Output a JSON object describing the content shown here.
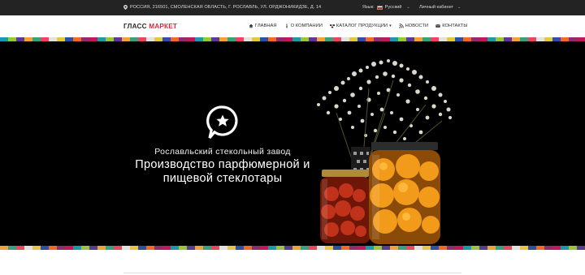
{
  "topbar": {
    "address": "РОССИЯ, 216501, СМОЛЕНСКАЯ ОБЛАСТЬ, Г. РОСЛАВЛЬ, УЛ. ОРДЖОНИКИДЗЕ, Д. 14",
    "language_label": "Язык:",
    "language_value": "Русский",
    "cabinet_label": "Личный кабинет"
  },
  "navbar": {
    "logo_part1": "ГЛАСС",
    "logo_part2": "МАРКЕТ",
    "menu": [
      "ГЛАВНАЯ",
      "О КОМПАНИИ",
      "КАТАЛОГ ПРОДУКЦИИ",
      "НОВОСТИ",
      "КОНТАКТЫ"
    ]
  },
  "hero": {
    "subtitle": "Рославльский стекольный завод",
    "title_line1": "Производство парфюмерной и",
    "title_line2": "пищевой стеклотары"
  },
  "colors": {
    "accent": "#d6293a",
    "topbar_bg": "#232323",
    "stripe": [
      "#1b9aa8",
      "#e8475d",
      "#8a2f6e",
      "#f2a23b",
      "#2f4fa0",
      "#9bc53d",
      "#e2e2e2",
      "#c2185b",
      "#3aa17e",
      "#f06a2a",
      "#5b3c8c",
      "#e8c547"
    ]
  },
  "icons": [
    "map-pin-icon",
    "flag-ru-icon",
    "chevron-down-icon",
    "home-icon",
    "info-icon",
    "catalog-icon",
    "rss-icon",
    "envelope-icon",
    "brand-logo-icon"
  ]
}
